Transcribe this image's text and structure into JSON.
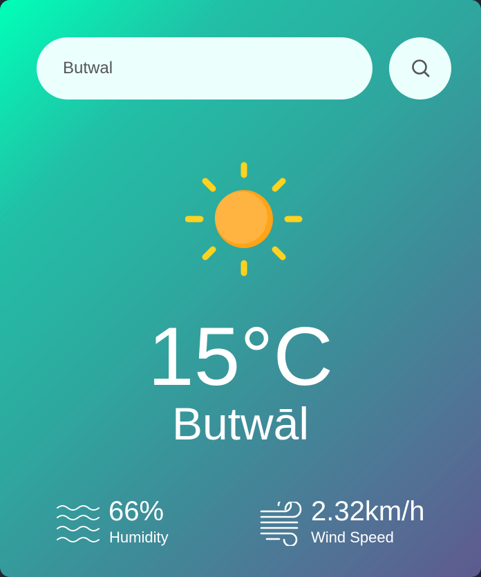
{
  "search": {
    "value": "Butwal",
    "button_icon": "search-icon"
  },
  "weather": {
    "icon": "sun-icon",
    "temperature": "15°C",
    "city": "Butwāl"
  },
  "details": {
    "humidity": {
      "value": "66%",
      "label": "Humidity",
      "icon": "humidity-waves-icon"
    },
    "wind": {
      "value": "2.32km/h",
      "label": "Wind Speed",
      "icon": "wind-icon"
    }
  },
  "colors": {
    "gradient_start": "#00ffb8",
    "gradient_end": "#5e5a8f",
    "search_bg": "#ebfffc",
    "sun_core": "#ffb340",
    "sun_rays": "#ffd21f",
    "text": "#ffffff"
  }
}
